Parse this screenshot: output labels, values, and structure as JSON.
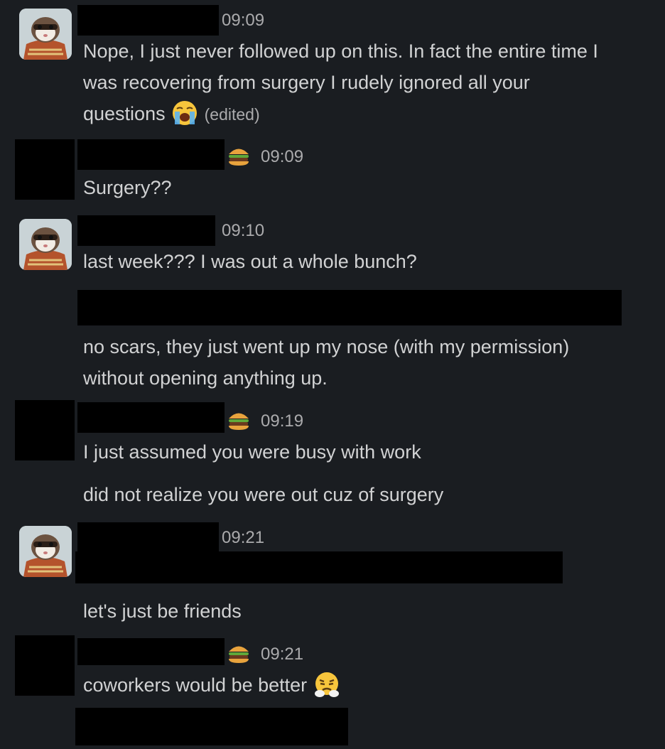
{
  "messages": [
    {
      "timestamp": "09:09",
      "lines": [
        "Nope, I just never followed up on this. In fact the entire time I",
        "was recovering from surgery I rudely ignored all your",
        "questions"
      ],
      "emoji": "loudly-crying-face",
      "edited_label": "(edited)"
    },
    {
      "timestamp": "09:09",
      "status_emoji": "hamburger",
      "lines": [
        "Surgery??"
      ]
    },
    {
      "timestamp": "09:10",
      "lines": [
        "last week??? I was out a whole bunch?",
        "no scars, they just went up my nose (with my permission)",
        "without opening anything up."
      ]
    },
    {
      "timestamp": "09:19",
      "status_emoji": "hamburger",
      "lines": [
        "I just assumed you were busy with work",
        "did not realize you were out cuz of surgery"
      ]
    },
    {
      "timestamp": "09:21",
      "lines": [
        "let's just be friends"
      ]
    },
    {
      "timestamp": "09:21",
      "status_emoji": "hamburger",
      "lines": [
        "coworkers would be better"
      ],
      "emoji": "face-with-steam-from-nose"
    }
  ]
}
